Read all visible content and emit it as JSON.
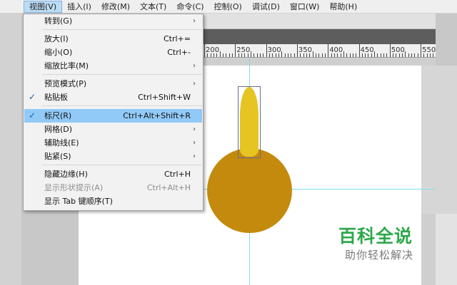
{
  "menubar": {
    "items": [
      "视图(V)",
      "插入(I)",
      "修改(M)",
      "文本(T)",
      "命令(C)",
      "控制(O)",
      "调试(D)",
      "窗口(W)",
      "帮助(H)"
    ]
  },
  "ruler": {
    "labels": [
      "200",
      "250",
      "300",
      "350",
      "400",
      "450",
      "500",
      "550"
    ]
  },
  "menu": {
    "items": [
      {
        "label": "转到(G)",
        "shortcut": "",
        "submenu": true,
        "checked": false,
        "selected": false,
        "disabled": false
      },
      {
        "label": "放大(I)",
        "shortcut": "Ctrl+=",
        "submenu": false,
        "checked": false,
        "selected": false,
        "disabled": false
      },
      {
        "label": "缩小(O)",
        "shortcut": "Ctrl+-",
        "submenu": false,
        "checked": false,
        "selected": false,
        "disabled": false
      },
      {
        "label": "缩放比率(M)",
        "shortcut": "",
        "submenu": true,
        "checked": false,
        "selected": false,
        "disabled": false
      },
      {
        "label": "预览模式(P)",
        "shortcut": "",
        "submenu": true,
        "checked": false,
        "selected": false,
        "disabled": false
      },
      {
        "label": "粘贴板",
        "shortcut": "Ctrl+Shift+W",
        "submenu": false,
        "checked": true,
        "selected": false,
        "disabled": false
      },
      {
        "label": "标尺(R)",
        "shortcut": "Ctrl+Alt+Shift+R",
        "submenu": false,
        "checked": true,
        "selected": true,
        "disabled": false
      },
      {
        "label": "网格(D)",
        "shortcut": "",
        "submenu": true,
        "checked": false,
        "selected": false,
        "disabled": false
      },
      {
        "label": "辅助线(E)",
        "shortcut": "",
        "submenu": true,
        "checked": false,
        "selected": false,
        "disabled": false
      },
      {
        "label": "贴紧(S)",
        "shortcut": "",
        "submenu": true,
        "checked": false,
        "selected": false,
        "disabled": false
      },
      {
        "label": "隐藏边缘(H)",
        "shortcut": "Ctrl+H",
        "submenu": false,
        "checked": false,
        "selected": false,
        "disabled": false
      },
      {
        "label": "显示形状提示(A)",
        "shortcut": "Ctrl+Alt+H",
        "submenu": false,
        "checked": false,
        "selected": false,
        "disabled": true
      },
      {
        "label": "显示 Tab 键顺序(T)",
        "shortcut": "",
        "submenu": false,
        "checked": false,
        "selected": false,
        "disabled": false
      }
    ]
  },
  "glyphs": {
    "arrow": "›",
    "check": "✓"
  },
  "watermark": {
    "title": "百科全说",
    "subtitle": "助你轻松解决"
  },
  "colors": {
    "circle": "#c48a0e",
    "drop": "#e6c523",
    "selected": "#91c9f7",
    "watermark": "#2ea84b"
  }
}
